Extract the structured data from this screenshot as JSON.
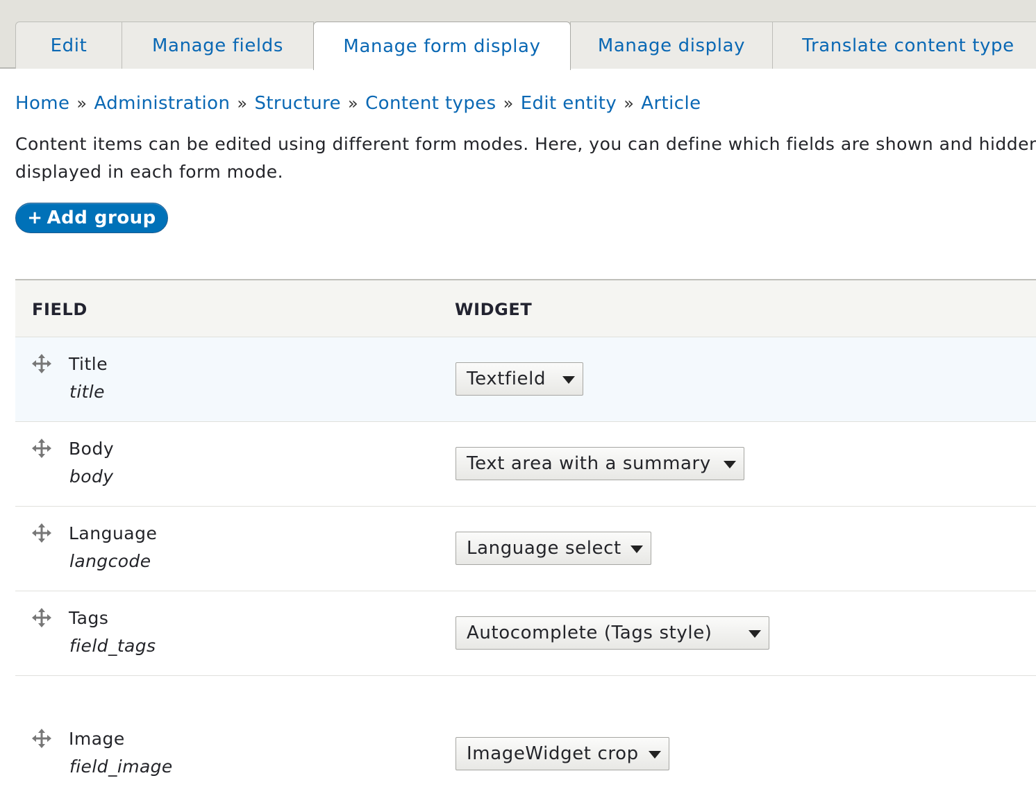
{
  "tabs": [
    {
      "label": "Edit",
      "active": false
    },
    {
      "label": "Manage fields",
      "active": false
    },
    {
      "label": "Manage form display",
      "active": true
    },
    {
      "label": "Manage display",
      "active": false
    },
    {
      "label": "Translate content type",
      "active": false
    }
  ],
  "breadcrumb": {
    "separator": "»",
    "items": [
      "Home",
      "Administration",
      "Structure",
      "Content types",
      "Edit entity",
      "Article"
    ]
  },
  "description": {
    "line1": "Content items can be edited using different form modes. Here, you can define which fields are shown and hidden wh",
    "line2": "displayed in each form mode."
  },
  "add_group": {
    "icon": "plus-icon",
    "plus": "+",
    "label": "Add group"
  },
  "table": {
    "headers": {
      "field": "FIELD",
      "widget": "WIDGET"
    },
    "rows": [
      {
        "label": "Title",
        "machine_name": "title",
        "widget": "Textfield"
      },
      {
        "label": "Body",
        "machine_name": "body",
        "widget": "Text area with a summary"
      },
      {
        "label": "Language",
        "machine_name": "langcode",
        "widget": "Language select"
      },
      {
        "label": "Tags",
        "machine_name": "field_tags",
        "widget": "Autocomplete (Tags style)"
      },
      {
        "label": "Image",
        "machine_name": "field_image",
        "widget": "ImageWidget crop"
      }
    ]
  },
  "colors": {
    "link": "#0a68b4",
    "primary_button": "#0071b8",
    "row_highlight": "#f4f9fd"
  }
}
